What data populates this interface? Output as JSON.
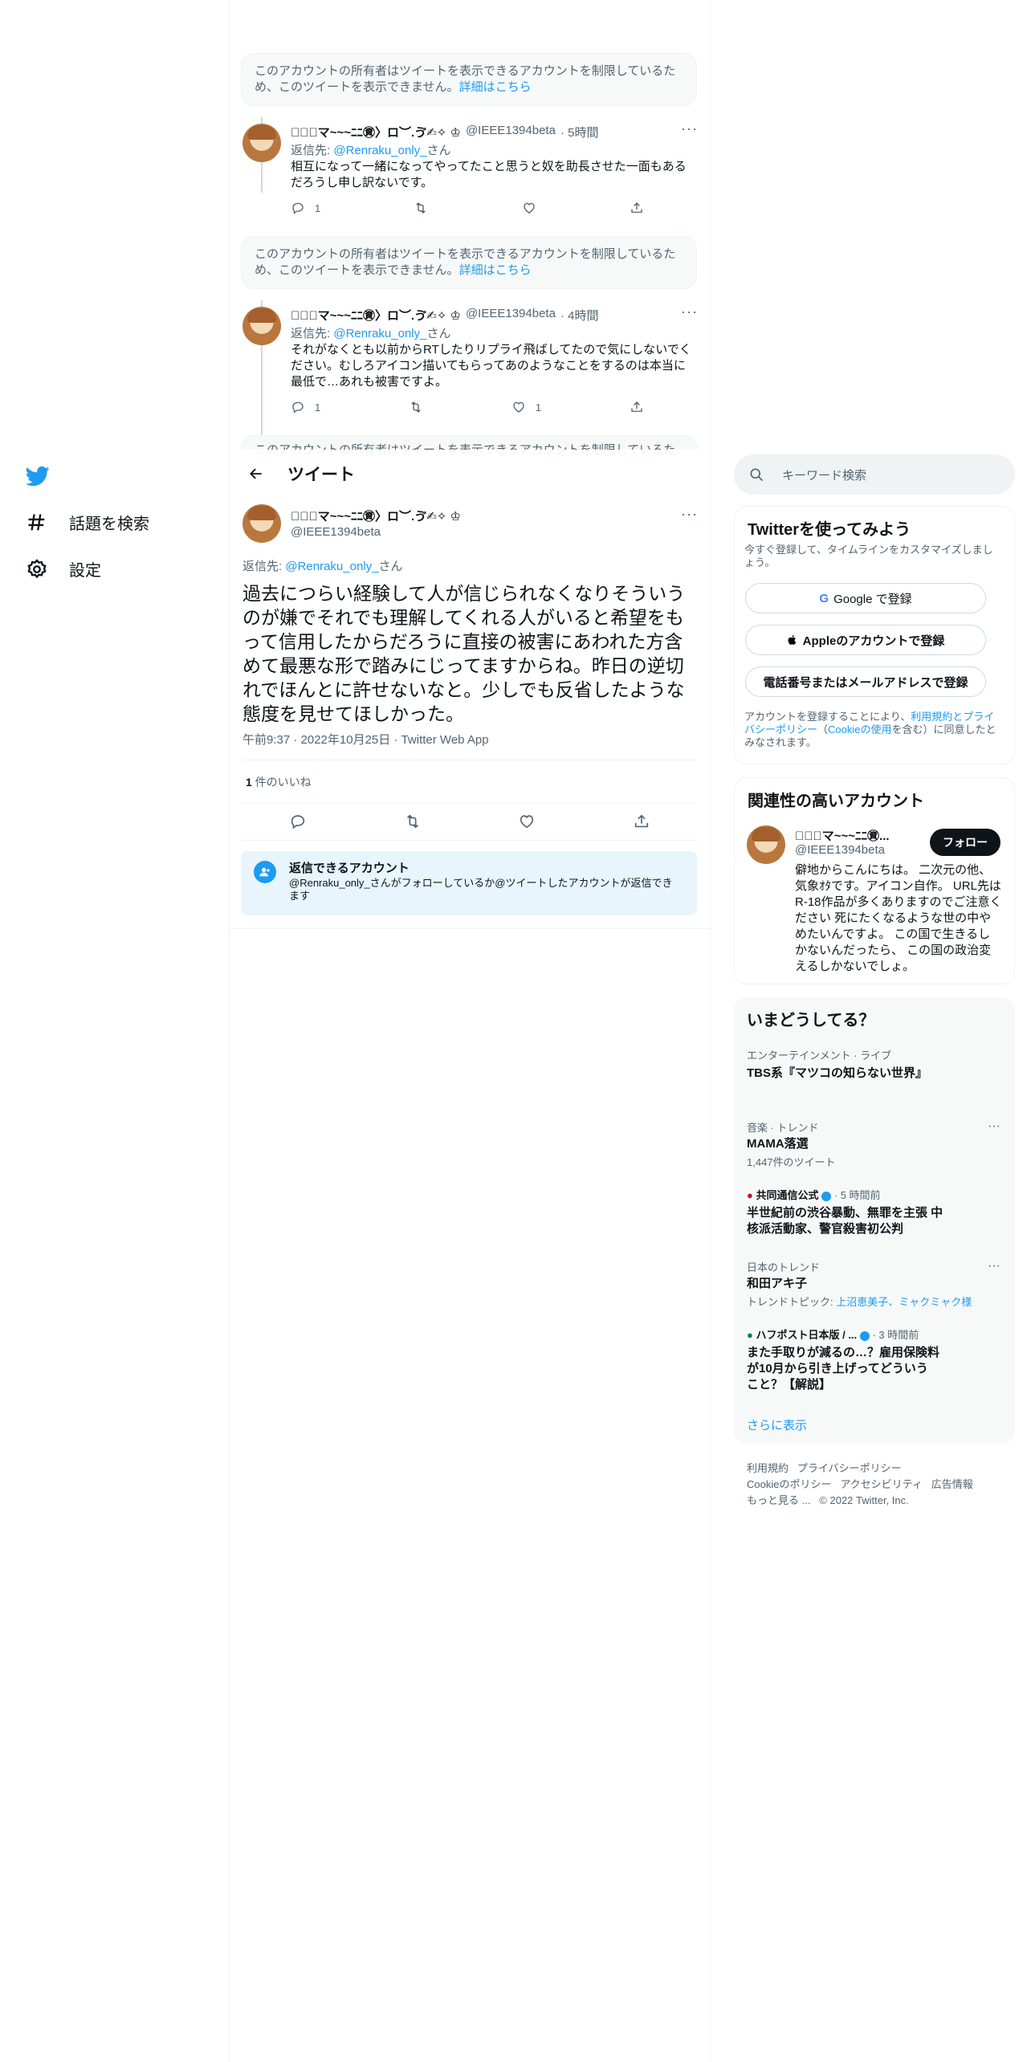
{
  "nav": {
    "explore_label": "話題を検索",
    "settings_label": "設定"
  },
  "thread": {
    "notice_text": "このアカウントの所有者はツイートを表示できるアカウントを制限しているため、このツイートを表示できません。",
    "notice_link": "詳細はこちら",
    "display_name": "━ื⑱マ~~~ﾆﾆ㊮〉ロ︶.ゔ✍︎✧ ♔",
    "handle": "@IEEE1394beta",
    "reply_prefix": "返信先: ",
    "reply_to": "@Renraku_only_",
    "reply_suffix": "さん",
    "tweet1": {
      "time": "· 5時間",
      "text": "相互になって一緒になってやってたこと思うと奴を助長させた一面もあるだろうし申し訳ないです。",
      "reply_count": "1"
    },
    "tweet2": {
      "time": "· 4時間",
      "text": "それがなくとも以前からRTしたりリプライ飛ばしてたので気にしないでください。むしろアイコン描いてもらってあのようなことをするのは本当に最低で…あれも被害ですよ。",
      "reply_count": "1",
      "like_count": "1"
    },
    "clipped_notice": "このアカウントの所有者はツイートを表示できるアカウントを制限しているた"
  },
  "header": {
    "title": "ツイート"
  },
  "main_tweet": {
    "display_name": "━ื⑱マ~~~ﾆﾆ㊮〉ロ︶.ゔ✍︎✧ ♔",
    "handle": "@IEEE1394beta",
    "reply_prefix": "返信先: ",
    "reply_to": "@Renraku_only_",
    "reply_suffix": "さん",
    "text": "過去につらい経験して人が信じられなくなりそういうのが嫌でそれでも理解してくれる人がいると希望をもって信用したからだろうに直接の被害にあわれた方含めて最悪な形で踏みにじってますからね。昨日の逆切れでほんとに許せないなと。少しでも反省したような態度を見せてほしかった。",
    "timestamp": "午前9:37 · 2022年10月25日 · Twitter Web App",
    "likes_count": "1",
    "likes_label": " 件のいいね",
    "reply_info_title": "返信できるアカウント",
    "reply_info_text": "@Renraku_only_さんがフォローしているか@ツイートしたアカウントが返信できます"
  },
  "search": {
    "placeholder": "キーワード検索"
  },
  "signup": {
    "title": "Twitterを使ってみよう",
    "subtitle": "今すぐ登録して、タイムラインをカスタマイズしましょう。",
    "google_label": "Google で登録",
    "apple_label": "Appleのアカウントで登録",
    "phone_label": "電話番号またはメールアドレスで登録",
    "legal_1": "アカウントを登録することにより、",
    "legal_terms": "利用規約とプライバシーポリシー",
    "legal_2": "（",
    "legal_cookie": "Cookieの使用",
    "legal_3": "を含む）に同意したとみなされます。"
  },
  "related": {
    "title": "関連性の高いアカウント",
    "name": "━ื⑱マ~~~ﾆﾆ㊮...",
    "handle": "@IEEE1394beta",
    "follow_label": "フォロー",
    "bio": "僻地からこんにちは。 二次元の他、気象ｵﾀです。アイコン自作。 URL先はR-18作品が多くありますのでご注意ください 死にたくなるような世の中やめたいんですよ。 この国で生きるしかないんだったら、 この国の政治変えるしかないでしょ。"
  },
  "trends": {
    "title": "いまどうしてる？",
    "items": [
      {
        "category": "エンターテインメント · ライブ",
        "name": "TBS系『マツコの知らない世界』"
      },
      {
        "category": "音楽 · トレンド",
        "name": "MAMA落選",
        "count": "1,447件のツイート"
      },
      {
        "source": "共同通信公式",
        "time": "· 5 時間前",
        "name": "半世紀前の渋谷暴動、無罪を主張 中核派活動家、警官殺害初公判"
      },
      {
        "category": "日本のトレンド",
        "name": "和田アキ子",
        "topic_prefix": "トレンドトピック: ",
        "topic": "上沼恵美子、ミャクミャク様"
      },
      {
        "source": "ハフポスト日本版 / ...",
        "time": "· 3 時間前",
        "name": "また手取りが減るの…？雇用保険料が10月から引き上げってどういうこと？【解説】"
      }
    ],
    "show_more": "さらに表示"
  },
  "footer": {
    "terms": "利用規約",
    "privacy": "プライバシーポリシー",
    "cookie": "Cookieのポリシー",
    "accessibility": "アクセシビリティ",
    "ads": "広告情報",
    "more": "もっと見る ...",
    "copyright": "© 2022 Twitter, Inc."
  },
  "colors": {
    "accent": "#1d9bf0",
    "muted": "#536471",
    "border": "#eff3f4"
  }
}
